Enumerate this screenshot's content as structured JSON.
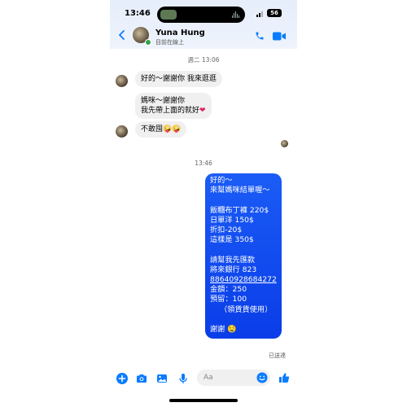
{
  "status_bar": {
    "time": "13:46",
    "battery": "56"
  },
  "header": {
    "name": "Yuna Hung",
    "status": "目前在線上"
  },
  "day_stamp": "週二 13:06",
  "incoming": [
    "好的～謝謝你 我來逛逛",
    "媽咪～謝謝你",
    "我先帶上面的就好",
    "不敢囤",
    "🤪🤪"
  ],
  "time_stamp": "13:46",
  "outgoing": {
    "lines": [
      "好的～",
      "來幫媽咪結單喔～",
      "",
      "飯糰布丁褲 220$",
      "日單洋 150$",
      "折扣-20$",
      "這樣是 350$",
      "",
      "請幫我先匯款",
      "將來銀行 823",
      "88640928684272",
      "金額：250",
      "預留：100",
      "（領貨貨使用）",
      "",
      "謝謝"
    ],
    "emoji": "🤤"
  },
  "read_receipt": "已送達",
  "composer": {
    "placeholder": "Aa"
  },
  "colors": {
    "accent": "#0a7cff",
    "bubble_out": "#1b5cf6",
    "online": "#31a24c"
  }
}
